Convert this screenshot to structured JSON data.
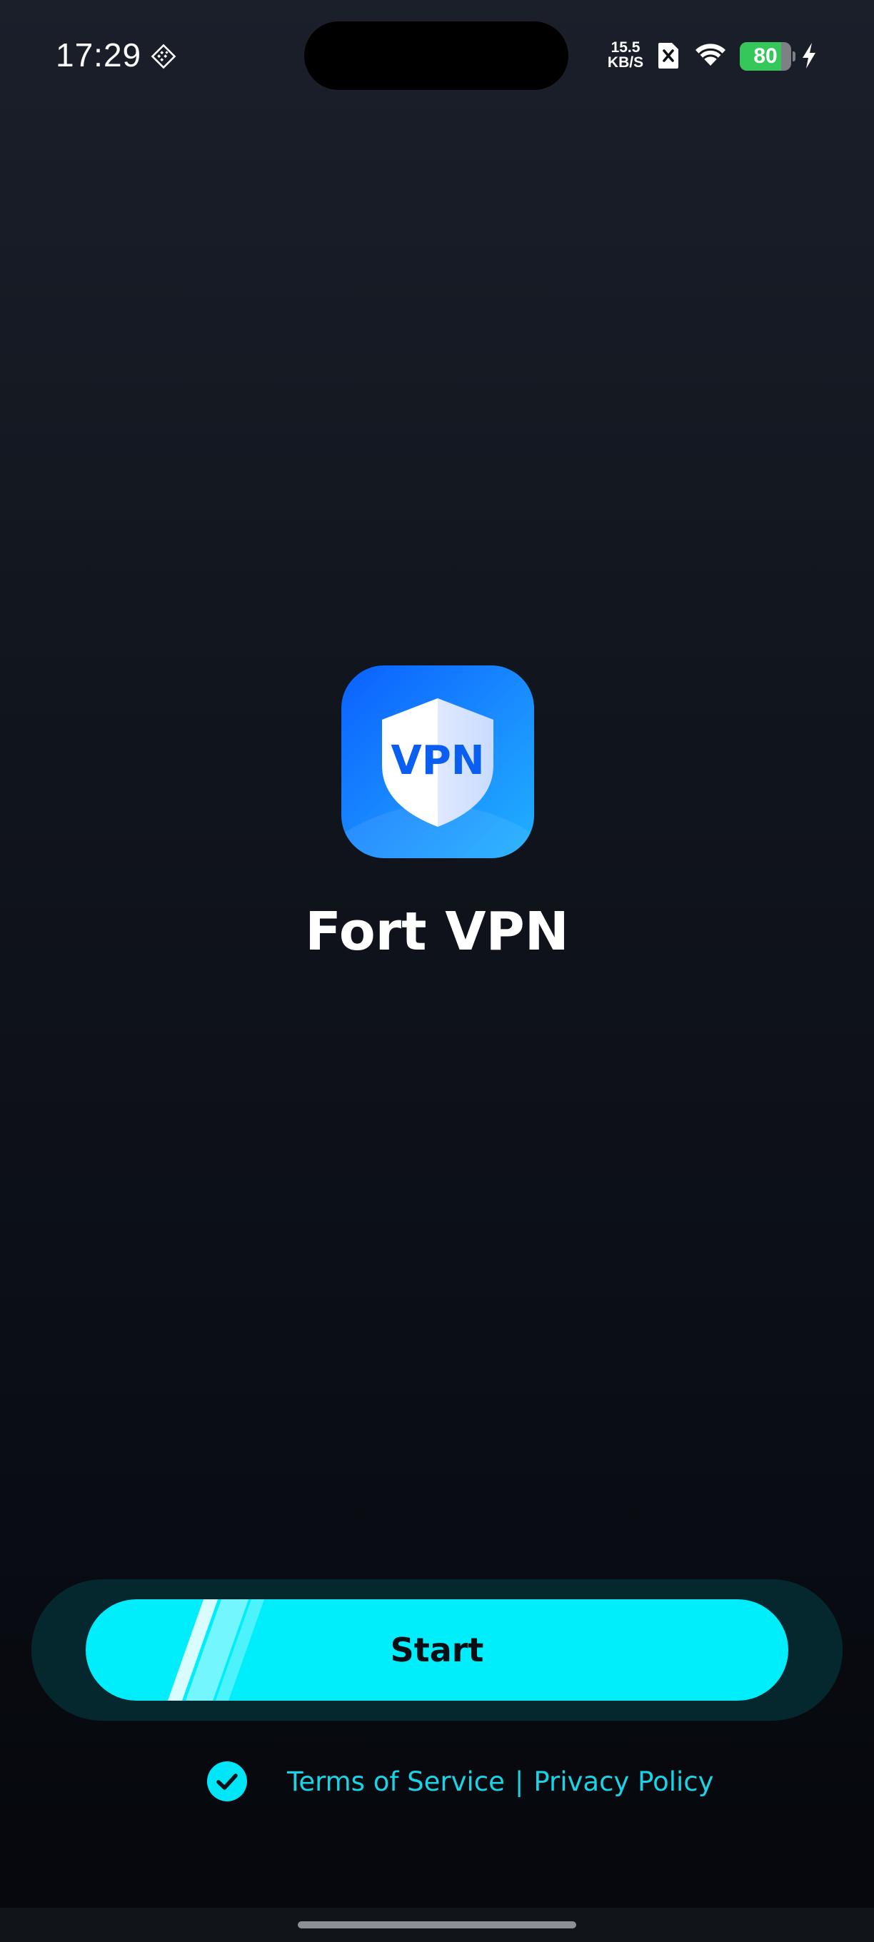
{
  "status_bar": {
    "time": "17:29",
    "net_speed_value": "15.5",
    "net_speed_unit": "KB/S",
    "battery_level": "80",
    "battery_fraction": 0.8,
    "battery_color": "#35c75a",
    "icons": [
      "notification-badge-icon",
      "sim-card-off-icon",
      "wifi-icon",
      "battery-icon",
      "charging-bolt-icon"
    ]
  },
  "app": {
    "name": "Fort VPN",
    "logo_text": "VPN",
    "logo_gradient": [
      "#0a60ff",
      "#1fb1ff"
    ]
  },
  "start_button": {
    "label": "Start",
    "color": "#00eefb"
  },
  "legal": {
    "consent_checked": true,
    "terms_label": "Terms of Service",
    "separator": "|",
    "privacy_label": "Privacy Policy",
    "link_color": "#18d4e6"
  },
  "colors": {
    "background_top": "#1b1f2a",
    "background_bottom": "#05070c",
    "start_track": "#05282f"
  }
}
